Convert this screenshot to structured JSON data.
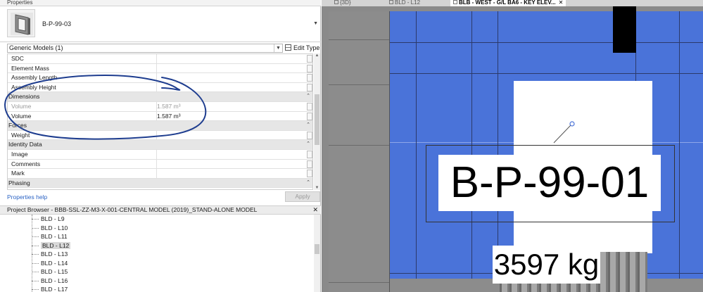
{
  "properties": {
    "title": "Properties",
    "type_name": "B-P-99-03",
    "category": "Generic Models (1)",
    "edit_type_label": "Edit Type",
    "rows": [
      {
        "kind": "param",
        "key": "SDC",
        "value": ""
      },
      {
        "kind": "param",
        "key": "Element Mass",
        "value": ""
      },
      {
        "kind": "param",
        "key": "Assembly Length",
        "value": ""
      },
      {
        "kind": "param",
        "key": "Assembly Height",
        "value": ""
      },
      {
        "kind": "group",
        "key": "Dimensions"
      },
      {
        "kind": "param",
        "key": "Volume",
        "value": "1.587 m³",
        "dim": true
      },
      {
        "kind": "param",
        "key": "Volume",
        "value": "1.587 m³"
      },
      {
        "kind": "group",
        "key": "Forces"
      },
      {
        "kind": "param",
        "key": "Weight",
        "value": ""
      },
      {
        "kind": "group",
        "key": "Identity Data"
      },
      {
        "kind": "param",
        "key": "Image",
        "value": ""
      },
      {
        "kind": "param",
        "key": "Comments",
        "value": ""
      },
      {
        "kind": "param",
        "key": "Mark",
        "value": ""
      },
      {
        "kind": "group",
        "key": "Phasing"
      }
    ],
    "help_link": "Properties help",
    "apply_label": "Apply"
  },
  "project_browser": {
    "title": "Project Browser - BBB-SSL-ZZ-M3-X-001-CENTRAL MODEL (2019)_STAND-ALONE MODEL",
    "items": [
      "BLD - L9",
      "BLD - L10",
      "BLD - L11",
      "BLD - L12",
      "BLD - L13",
      "BLD - L14",
      "BLD - L15",
      "BLD - L16",
      "BLD - L17"
    ],
    "selected_index": 3
  },
  "view": {
    "tabs": [
      {
        "label": "{3D}",
        "active": false
      },
      {
        "label": "BLD - L12",
        "active": false
      },
      {
        "label": "BLB - WEST - G/L BA6 - KEY ELEV...",
        "active": true
      }
    ],
    "tag_label": "B-P-99-01",
    "mass_label": "3597 kg"
  },
  "colors": {
    "view_blue": "#4a73d9",
    "annotation_ink": "#1e3d8f",
    "link": "#2b63c4"
  }
}
